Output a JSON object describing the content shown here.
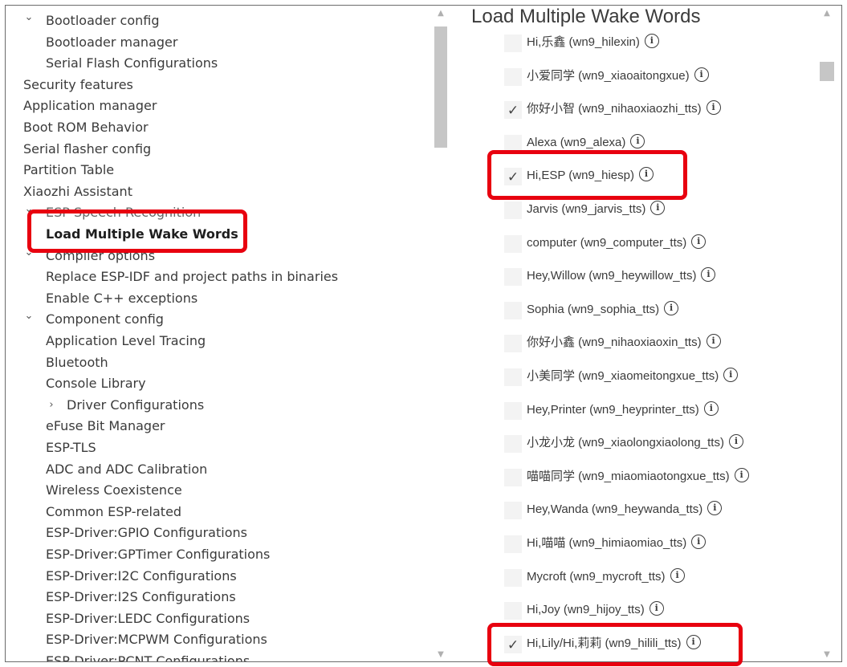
{
  "tree": {
    "items": [
      {
        "label": "Bootloader config",
        "indent": 1,
        "chevron": "down"
      },
      {
        "label": "Bootloader manager",
        "indent": 2
      },
      {
        "label": "Serial Flash Configurations",
        "indent": 2
      },
      {
        "label": "Security features",
        "indent": 0
      },
      {
        "label": "Application manager",
        "indent": 0
      },
      {
        "label": "Boot ROM Behavior",
        "indent": 0
      },
      {
        "label": "Serial flasher config",
        "indent": 0
      },
      {
        "label": "Partition Table",
        "indent": 0
      },
      {
        "label": "Xiaozhi Assistant",
        "indent": 0
      },
      {
        "label": "ESP Speech Recognition",
        "indent": 1,
        "chevron": "down"
      },
      {
        "label": "Load Multiple Wake Words",
        "indent": 2,
        "selected": true
      },
      {
        "label": "Compiler options",
        "indent": 1,
        "chevron": "down"
      },
      {
        "label": "Replace ESP-IDF and project paths in binaries",
        "indent": 2
      },
      {
        "label": "Enable C++ exceptions",
        "indent": 2
      },
      {
        "label": "Component config",
        "indent": 1,
        "chevron": "down"
      },
      {
        "label": "Application Level Tracing",
        "indent": 2
      },
      {
        "label": "Bluetooth",
        "indent": 2
      },
      {
        "label": "Console Library",
        "indent": 2
      },
      {
        "label": "Driver Configurations",
        "indent": 3,
        "chevron": "right"
      },
      {
        "label": "eFuse Bit Manager",
        "indent": 2
      },
      {
        "label": "ESP-TLS",
        "indent": 2
      },
      {
        "label": "ADC and ADC Calibration",
        "indent": 2
      },
      {
        "label": "Wireless Coexistence",
        "indent": 2
      },
      {
        "label": "Common ESP-related",
        "indent": 2
      },
      {
        "label": "ESP-Driver:GPIO Configurations",
        "indent": 2
      },
      {
        "label": "ESP-Driver:GPTimer Configurations",
        "indent": 2
      },
      {
        "label": "ESP-Driver:I2C Configurations",
        "indent": 2
      },
      {
        "label": "ESP-Driver:I2S Configurations",
        "indent": 2
      },
      {
        "label": "ESP-Driver:LEDC Configurations",
        "indent": 2
      },
      {
        "label": "ESP-Driver:MCPWM Configurations",
        "indent": 2
      },
      {
        "label": "ESP-Driver:PCNT Configurations",
        "indent": 2
      }
    ]
  },
  "pane": {
    "title": "Load Multiple Wake Words",
    "options": [
      {
        "label": "Hi,乐鑫 (wn9_hilexin)",
        "checked": false
      },
      {
        "label": "小爱同学 (wn9_xiaoaitongxue)",
        "checked": false
      },
      {
        "label": "你好小智 (wn9_nihaoxiaozhi_tts)",
        "checked": true
      },
      {
        "label": "Alexa (wn9_alexa)",
        "checked": false
      },
      {
        "label": "Hi,ESP (wn9_hiesp)",
        "checked": true
      },
      {
        "label": "Jarvis (wn9_jarvis_tts)",
        "checked": false
      },
      {
        "label": "computer (wn9_computer_tts)",
        "checked": false
      },
      {
        "label": "Hey,Willow (wn9_heywillow_tts)",
        "checked": false
      },
      {
        "label": "Sophia (wn9_sophia_tts)",
        "checked": false
      },
      {
        "label": "你好小鑫 (wn9_nihaoxiaoxin_tts)",
        "checked": false
      },
      {
        "label": "小美同学 (wn9_xiaomeitongxue_tts)",
        "checked": false
      },
      {
        "label": "Hey,Printer (wn9_heyprinter_tts)",
        "checked": false
      },
      {
        "label": "小龙小龙 (wn9_xiaolongxiaolong_tts)",
        "checked": false
      },
      {
        "label": "喵喵同学 (wn9_miaomiaotongxue_tts)",
        "checked": false
      },
      {
        "label": "Hey,Wanda (wn9_heywanda_tts)",
        "checked": false
      },
      {
        "label": "Hi,喵喵 (wn9_himiaomiao_tts)",
        "checked": false
      },
      {
        "label": "Mycroft (wn9_mycroft_tts)",
        "checked": false
      },
      {
        "label": "Hi,Joy (wn9_hijoy_tts)",
        "checked": false
      },
      {
        "label": "Hi,Lily/Hi,莉莉 (wn9_hilili_tts)",
        "checked": true
      }
    ],
    "check_glyph": "✓",
    "info_glyph": "i"
  },
  "icons": {
    "chevron_down": "⌄",
    "chevron_right": "›",
    "scroll_up": "▲",
    "scroll_down": "▼"
  },
  "colors": {
    "highlight": "#e8000f",
    "scroll_thumb": "#c6c6c6",
    "checkbox_bg": "#f3f3f3"
  }
}
